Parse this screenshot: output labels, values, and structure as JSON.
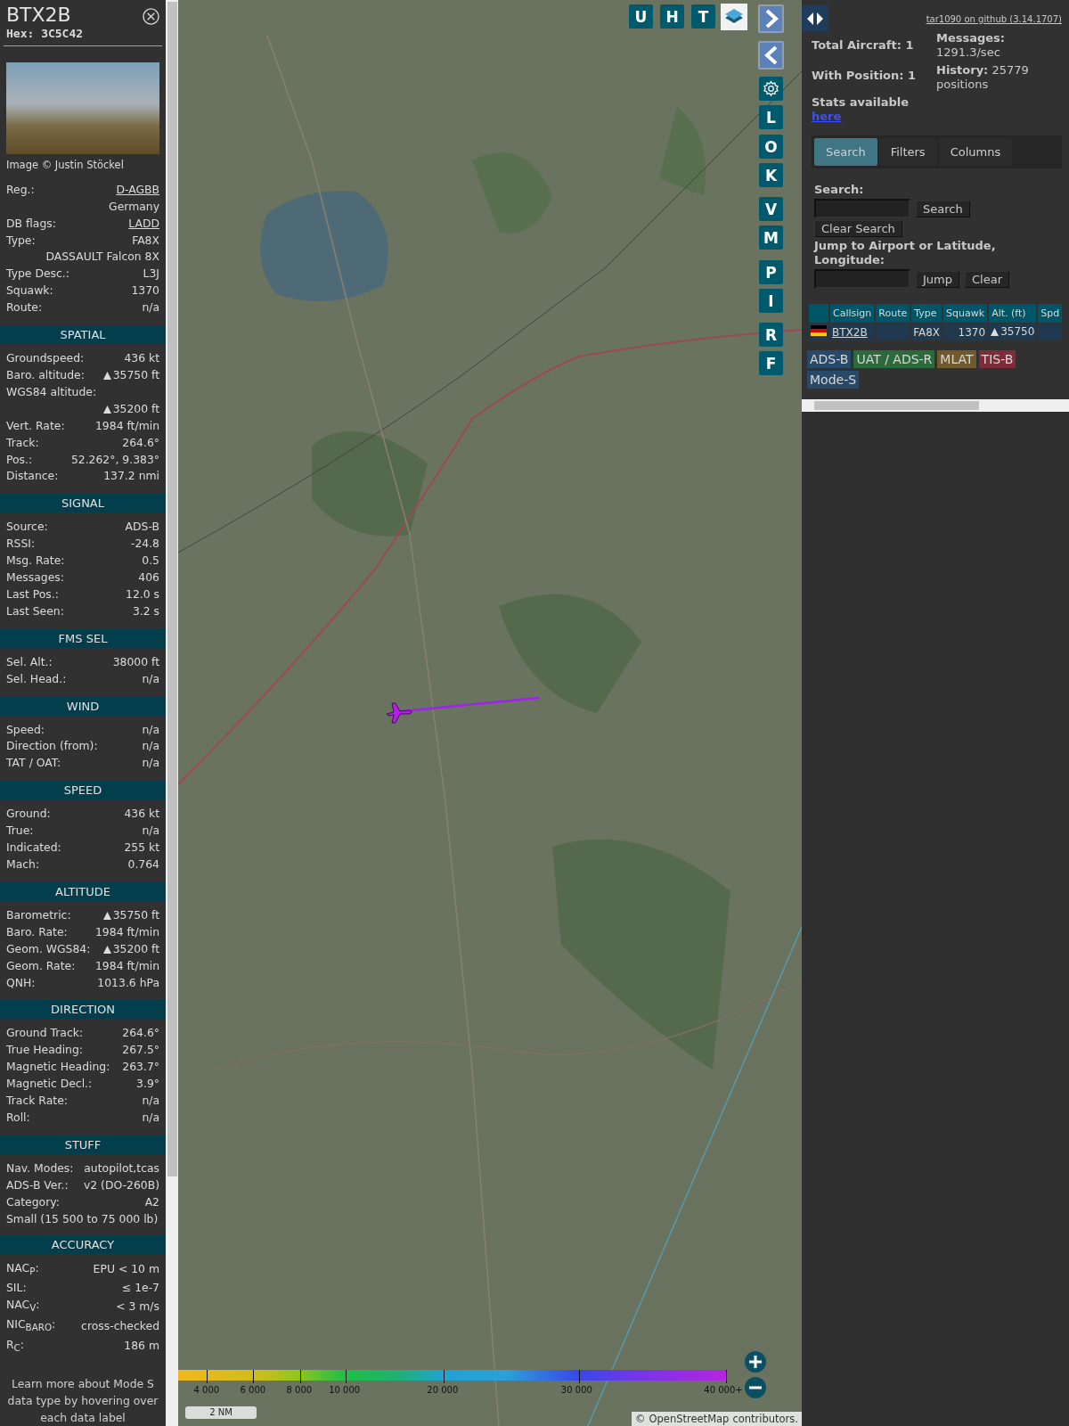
{
  "detail": {
    "callsign": "BTX2B",
    "hex": "Hex: 3C5C42",
    "photo_credit": "Image © Justin Stöckel",
    "sections": [
      {
        "rows": [
          {
            "kind": "pair",
            "label": "Reg.:",
            "value": "D-AGBB",
            "link": true
          },
          {
            "kind": "value",
            "value": "Germany"
          },
          {
            "kind": "pair",
            "label": "DB flags:",
            "value": "LADD",
            "link": true
          },
          {
            "kind": "pair",
            "label": "Type:",
            "value": "FA8X"
          },
          {
            "kind": "value",
            "value": "DASSAULT Falcon 8X"
          },
          {
            "kind": "pair",
            "label": "Type Desc.:",
            "value": "L3J"
          },
          {
            "kind": "pair",
            "label": "Squawk:",
            "value": "1370"
          },
          {
            "kind": "pair",
            "label": "Route:",
            "value": "n/a"
          }
        ]
      },
      {
        "heading": "SPATIAL",
        "rows": [
          {
            "kind": "pair",
            "label": "Groundspeed:",
            "value": "436 kt"
          },
          {
            "kind": "pair",
            "label": "Baro. altitude:",
            "value": "35750 ft",
            "climbing": true
          },
          {
            "kind": "label",
            "label": "WGS84 altitude:"
          },
          {
            "kind": "value",
            "value": "35200 ft",
            "climbing": true
          },
          {
            "kind": "pair",
            "label": "Vert. Rate:",
            "value": "1984 ft/min"
          },
          {
            "kind": "pair",
            "label": "Track:",
            "value": "264.6°"
          },
          {
            "kind": "pair",
            "label": "Pos.:",
            "value": "52.262°, 9.383°"
          },
          {
            "kind": "pair",
            "label": "Distance:",
            "value": "137.2 nmi"
          }
        ]
      },
      {
        "heading": "SIGNAL",
        "rows": [
          {
            "kind": "pair",
            "label": "Source:",
            "value": "ADS-B"
          },
          {
            "kind": "pair",
            "label": "RSSI:",
            "value": "-24.8"
          },
          {
            "kind": "pair",
            "label": "Msg. Rate:",
            "value": "0.5"
          },
          {
            "kind": "pair",
            "label": "Messages:",
            "value": "406"
          },
          {
            "kind": "pair",
            "label": "Last Pos.:",
            "value": "12.0 s"
          },
          {
            "kind": "pair",
            "label": "Last Seen:",
            "value": "3.2 s"
          }
        ]
      },
      {
        "heading": "FMS SEL",
        "rows": [
          {
            "kind": "pair",
            "label": "Sel. Alt.:",
            "value": "38000 ft"
          },
          {
            "kind": "pair",
            "label": "Sel. Head.:",
            "value": "n/a"
          }
        ]
      },
      {
        "heading": "WIND",
        "rows": [
          {
            "kind": "pair",
            "label": "Speed:",
            "value": "n/a"
          },
          {
            "kind": "pair",
            "label": "Direction (from):",
            "value": "n/a"
          },
          {
            "kind": "pair",
            "label": "TAT / OAT:",
            "value": "n/a"
          }
        ]
      },
      {
        "heading": "SPEED",
        "rows": [
          {
            "kind": "pair",
            "label": "Ground:",
            "value": "436 kt"
          },
          {
            "kind": "pair",
            "label": "True:",
            "value": "n/a"
          },
          {
            "kind": "pair",
            "label": "Indicated:",
            "value": "255 kt"
          },
          {
            "kind": "pair",
            "label": "Mach:",
            "value": "0.764"
          }
        ]
      },
      {
        "heading": "ALTITUDE",
        "rows": [
          {
            "kind": "pair",
            "label": "Barometric:",
            "value": "35750 ft",
            "climbing": true
          },
          {
            "kind": "pair",
            "label": "Baro. Rate:",
            "value": "1984 ft/min"
          },
          {
            "kind": "pair",
            "label": "Geom. WGS84:",
            "value": "35200 ft",
            "climbing": true
          },
          {
            "kind": "pair",
            "label": "Geom. Rate:",
            "value": "1984 ft/min"
          },
          {
            "kind": "pair",
            "label": "QNH:",
            "value": "1013.6 hPa"
          }
        ]
      },
      {
        "heading": "DIRECTION",
        "rows": [
          {
            "kind": "pair",
            "label": "Ground Track:",
            "value": "264.6°"
          },
          {
            "kind": "pair",
            "label": "True Heading:",
            "value": "267.5°"
          },
          {
            "kind": "pair",
            "label": "Magnetic Heading:",
            "value": "263.7°"
          },
          {
            "kind": "pair",
            "label": "Magnetic Decl.:",
            "value": "3.9°"
          },
          {
            "kind": "pair",
            "label": "Track Rate:",
            "value": "n/a"
          },
          {
            "kind": "pair",
            "label": "Roll:",
            "value": "n/a"
          }
        ]
      },
      {
        "heading": "STUFF",
        "rows": [
          {
            "kind": "pair",
            "label": "Nav. Modes:",
            "value": "autopilot,tcas"
          },
          {
            "kind": "pair",
            "label": "ADS-B Ver.:",
            "value": "v2 (DO-260B)"
          },
          {
            "kind": "pair",
            "label": "Category:",
            "value": "A2"
          },
          {
            "kind": "text",
            "value": "Small (15 500 to 75 000 lb)"
          }
        ]
      },
      {
        "heading": "ACCURACY",
        "rows": [
          {
            "kind": "pair",
            "label": "NAC$_{P}$:",
            "value": "EPU < 10 m"
          },
          {
            "kind": "pair",
            "label": "SIL:",
            "value": "≤ 1e-7"
          },
          {
            "kind": "pair",
            "label": "NAC$_{V}$:",
            "value": "< 3 m/s"
          },
          {
            "kind": "pair",
            "label": "NIC$_{BARO}$:",
            "value": "cross-checked"
          },
          {
            "kind": "pair",
            "label": "R$_{C}$:",
            "value": "186 m"
          }
        ]
      }
    ],
    "footer": "Learn more about Mode S data type by hovering over each data label"
  },
  "map": {
    "top_buttons": [
      "U",
      "H",
      "T"
    ],
    "side_buttons": [
      {
        "kind": "next"
      },
      {
        "kind": "prev"
      },
      {
        "kind": "settings"
      },
      {
        "kind": "letter",
        "label": "L"
      },
      {
        "kind": "letter",
        "label": "O"
      },
      {
        "kind": "letter",
        "label": "K"
      },
      {
        "kind": "letter",
        "label": "V"
      },
      {
        "kind": "letter",
        "label": "M"
      },
      {
        "kind": "letter",
        "label": "P"
      },
      {
        "kind": "letter",
        "label": "I"
      },
      {
        "kind": "letter",
        "label": "R"
      },
      {
        "kind": "letter",
        "label": "F"
      }
    ],
    "legend_ticks": [
      "4 000",
      "6 000",
      "8 000",
      "10 000",
      "20 000",
      "30 000",
      "40 000+"
    ],
    "scale": "2 NM",
    "attribution_prefix": "©",
    "attribution_link": "OpenStreetMap",
    "attribution_suffix": "contributors."
  },
  "info": {
    "github_link": "tar1090 on github (3.14.1707)",
    "total": "Total Aircraft: 1",
    "with_position": "With Position: 1",
    "stats_label": "Stats available",
    "stats_link": "here",
    "messages": "**Messages:** 1291.3/sec",
    "history": "**History:** 25779 positions",
    "tabs": [
      {
        "label": "Search",
        "selected": true
      },
      {
        "label": "Filters",
        "selected": false
      },
      {
        "label": "Columns",
        "selected": false
      }
    ],
    "search": {
      "label": "Search:",
      "button": "Search",
      "clear": "Clear Search",
      "jump_label": "Jump to Airport or Latitude, Longitude:",
      "jump_button": "Jump",
      "clear_button": "Clear"
    },
    "table": {
      "columns": [
        "Callsign",
        "Route",
        "Type",
        "Squawk",
        "Alt. (ft)",
        "Spd"
      ],
      "rows": [
        {
          "callsign": "BTX2B",
          "type": "FA8X",
          "squawk": "1370",
          "altitude": "35750",
          "climbing": true
        }
      ]
    },
    "legend": [
      {
        "label": "ADS-B",
        "color": "#284a68"
      },
      {
        "label": "UAT / ADS-R",
        "color": "#2c6a3c"
      },
      {
        "label": "MLAT",
        "color": "#6e5a2e"
      },
      {
        "label": "TIS-B",
        "color": "#7d2d3a"
      },
      {
        "label": "Mode-S",
        "color": "#284a68"
      }
    ]
  }
}
